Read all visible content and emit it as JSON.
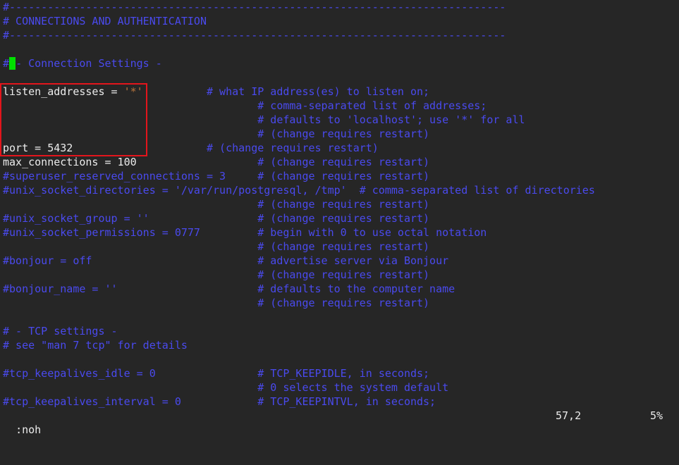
{
  "colors": {
    "background": "#262626",
    "comment": "#4a4aee",
    "text": "#ececec",
    "string": "#b8743c",
    "cursor": "#00e000",
    "highlight_box": "#e3151c"
  },
  "lines": [
    [
      [
        "#------------------------------------------------------------------------------",
        "c"
      ]
    ],
    [
      [
        "# CONNECTIONS AND AUTHENTICATION",
        "c"
      ]
    ],
    [
      [
        "#------------------------------------------------------------------------------",
        "c"
      ]
    ],
    [],
    [
      [
        "#",
        "c"
      ],
      [
        " ",
        "cursor"
      ],
      [
        "- Connection Settings -",
        "c"
      ]
    ],
    [],
    [
      [
        "listen_addresses = ",
        "n"
      ],
      [
        "'*'",
        "s"
      ],
      [
        "          # what IP address(es) to listen on;",
        "c"
      ]
    ],
    [
      [
        "                                        # comma-separated list of addresses;",
        "c"
      ]
    ],
    [
      [
        "                                        # defaults to 'localhost'; use '*' for all",
        "c"
      ]
    ],
    [
      [
        "                                        # (change requires restart)",
        "c"
      ]
    ],
    [
      [
        "port = 5432",
        "n"
      ],
      [
        "                     # (change requires restart)",
        "c"
      ]
    ],
    [
      [
        "max_connections = 100",
        "n"
      ],
      [
        "                   # (change requires restart)",
        "c"
      ]
    ],
    [
      [
        "#superuser_reserved_connections = 3     # (change requires restart)",
        "c"
      ]
    ],
    [
      [
        "#unix_socket_directories = '/var/run/postgresql, /tmp'  # comma-separated list of directories",
        "c"
      ]
    ],
    [
      [
        "                                        # (change requires restart)",
        "c"
      ]
    ],
    [
      [
        "#unix_socket_group = ''                 # (change requires restart)",
        "c"
      ]
    ],
    [
      [
        "#unix_socket_permissions = 0777         # begin with 0 to use octal notation",
        "c"
      ]
    ],
    [
      [
        "                                        # (change requires restart)",
        "c"
      ]
    ],
    [
      [
        "#bonjour = off                          # advertise server via Bonjour",
        "c"
      ]
    ],
    [
      [
        "                                        # (change requires restart)",
        "c"
      ]
    ],
    [
      [
        "#bonjour_name = ''                      # defaults to the computer name",
        "c"
      ]
    ],
    [
      [
        "                                        # (change requires restart)",
        "c"
      ]
    ],
    [],
    [
      [
        "# - TCP settings -",
        "c"
      ]
    ],
    [
      [
        "# see \"man 7 tcp\" for details",
        "c"
      ]
    ],
    [],
    [
      [
        "#tcp_keepalives_idle = 0                # TCP_KEEPIDLE, in seconds;",
        "c"
      ]
    ],
    [
      [
        "                                        # 0 selects the system default",
        "c"
      ]
    ],
    [
      [
        "#tcp_keepalives_interval = 0            # TCP_KEEPINTVL, in seconds;",
        "c"
      ]
    ]
  ],
  "status": {
    "command": ":noh",
    "position": "57,2",
    "percent": "5%"
  }
}
